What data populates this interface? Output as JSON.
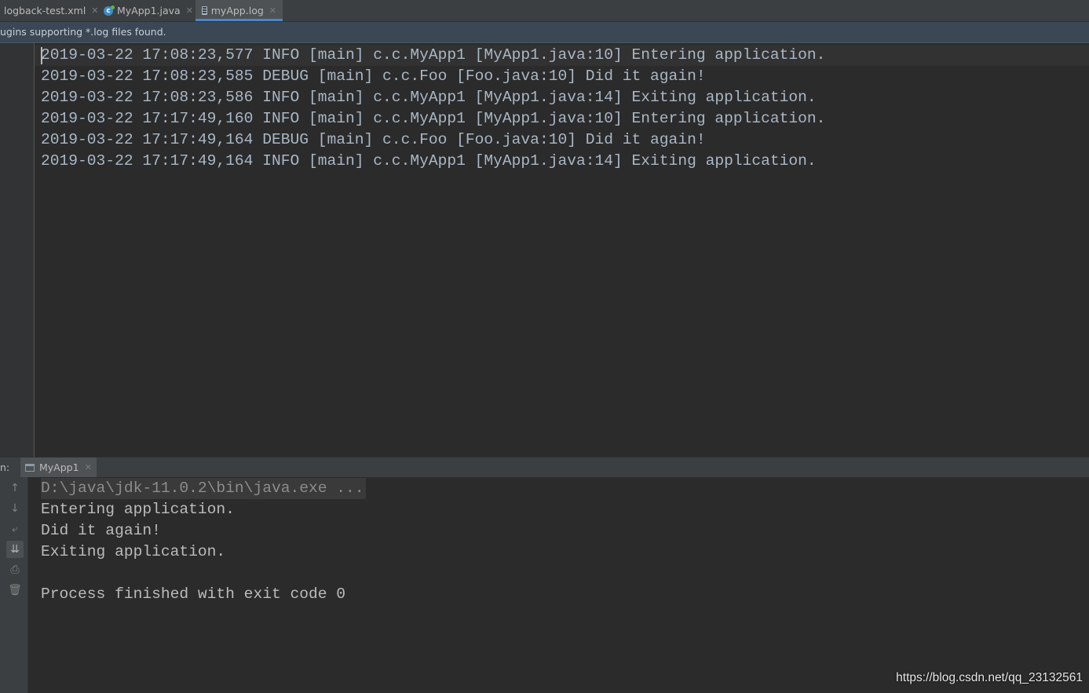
{
  "tabs": [
    {
      "label": "logback-test.xml",
      "icon": "xml-file-icon",
      "active": false
    },
    {
      "label": "MyApp1.java",
      "icon": "java-class-icon",
      "active": false
    },
    {
      "label": "myApp.log",
      "icon": "log-file-icon",
      "active": true
    }
  ],
  "notice": {
    "text": "ugins supporting *.log files found."
  },
  "editor": {
    "lines": [
      "2019-03-22 17:08:23,577 INFO [main] c.c.MyApp1 [MyApp1.java:10] Entering application.",
      "2019-03-22 17:08:23,585 DEBUG [main] c.c.Foo [Foo.java:10] Did it again!",
      "2019-03-22 17:08:23,586 INFO [main] c.c.MyApp1 [MyApp1.java:14] Exiting application.",
      "2019-03-22 17:17:49,160 INFO [main] c.c.MyApp1 [MyApp1.java:10] Entering application.",
      "2019-03-22 17:17:49,164 DEBUG [main] c.c.Foo [Foo.java:10] Did it again!",
      "2019-03-22 17:17:49,164 INFO [main] c.c.MyApp1 [MyApp1.java:14] Exiting application."
    ]
  },
  "run_panel": {
    "label": "n:",
    "tab_label": "MyApp1",
    "console_lines": [
      "D:\\java\\jdk-11.0.2\\bin\\java.exe ...",
      "Entering application.",
      "Did it again!",
      "Exiting application.",
      "",
      "Process finished with exit code 0"
    ]
  },
  "watermark": "https://blog.csdn.net/qq_23132561",
  "colors": {
    "accent": "#4a88c7",
    "editor_bg": "#2b2b2b",
    "text": "#a9b7c6"
  }
}
